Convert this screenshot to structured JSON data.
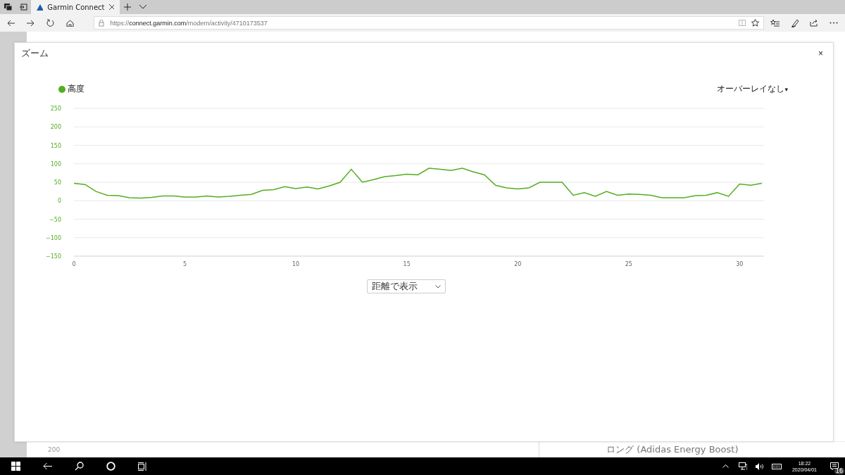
{
  "browser": {
    "tab_title": "Garmin Connect",
    "url": "https://**connect.garmin.com**/modern/activity/4710173537"
  },
  "background": {
    "axis_label": "200",
    "gear": "ロング (Adidas Energy Boost)"
  },
  "modal": {
    "title": "ズーム",
    "close": "×",
    "overlay": {
      "label": "オーバーレイなし",
      "caret": "▾"
    },
    "chart_data": {
      "type": "line",
      "grid": true,
      "ylim": [
        -150,
        250
      ],
      "xlim": [
        0,
        31.1
      ],
      "yticks": [
        250,
        200,
        150,
        100,
        50,
        0,
        -50,
        -100,
        -150
      ],
      "xticks": [
        0,
        5,
        10,
        15,
        20,
        25,
        30
      ],
      "x": [
        0,
        0.5,
        1,
        1.5,
        2,
        2.5,
        3,
        3.5,
        4,
        4.5,
        5,
        5.5,
        6,
        6.5,
        7,
        7.5,
        8,
        8.5,
        9,
        9.5,
        10,
        10.5,
        11,
        11.5,
        12,
        12.5,
        13,
        13.5,
        14,
        14.5,
        15,
        15.5,
        16,
        16.5,
        17,
        17.5,
        18,
        18.5,
        19,
        19.5,
        20,
        20.5,
        21,
        21.5,
        22,
        22.5,
        23,
        23.5,
        24,
        24.5,
        25,
        25.5,
        26,
        26.5,
        27,
        27.5,
        28,
        28.5,
        29,
        29.5,
        30,
        30.5,
        31
      ],
      "series": [
        {
          "name": "高度",
          "color": "#52ae1f",
          "values": [
            47,
            44,
            25,
            15,
            14,
            8,
            7,
            9,
            13,
            13,
            10,
            10,
            13,
            10,
            12,
            15,
            17,
            28,
            30,
            38,
            33,
            37,
            32,
            40,
            50,
            85,
            50,
            57,
            65,
            68,
            72,
            70,
            88,
            85,
            82,
            88,
            78,
            70,
            42,
            35,
            32,
            35,
            50,
            50,
            50,
            15,
            22,
            12,
            25,
            15,
            18,
            17,
            15,
            8,
            8,
            8,
            14,
            15,
            22,
            12,
            45,
            42,
            47
          ]
        }
      ]
    },
    "select": {
      "value": "距離で表示"
    }
  },
  "taskbar": {
    "time": "18:22",
    "date": "2020/04/01",
    "notifications": "16"
  }
}
